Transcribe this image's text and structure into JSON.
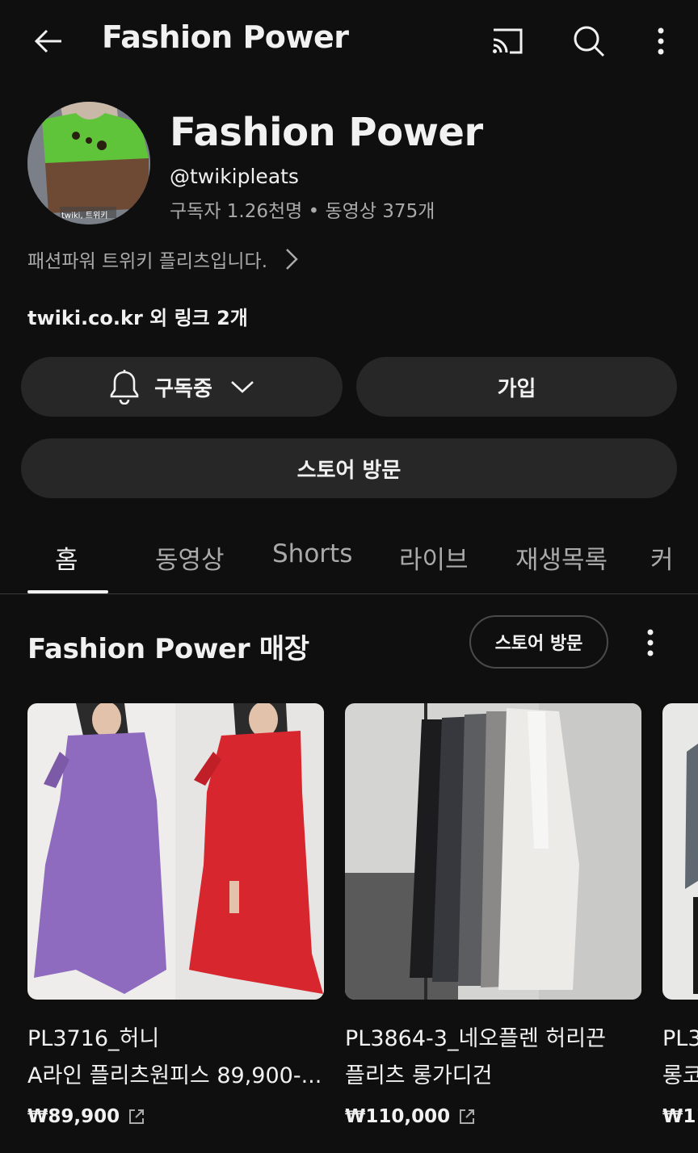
{
  "topbar": {
    "title": "Fashion Power"
  },
  "channel": {
    "name": "Fashion Power",
    "handle": "@twikipleats",
    "stats": "구독자 1.26천명 • 동영상 375개",
    "description": "패션파워 트위키 플리츠입니다.",
    "links": "twiki.co.kr 외 링크 2개",
    "avatar_caption": "twiki, 트위키"
  },
  "buttons": {
    "subscribed": "구독중",
    "join": "가입",
    "visit_store": "스토어 방문"
  },
  "tabs": [
    "홈",
    "동영상",
    "Shorts",
    "라이브",
    "재생목록",
    "커"
  ],
  "store_section": {
    "title": "Fashion Power 매장",
    "visit_store": "스토어 방문"
  },
  "products": [
    {
      "title_line1": "PL3716_허니",
      "title_line2": "A라인 플리츠원피스 89,900-...",
      "price": "₩89,900"
    },
    {
      "title_line1": "PL3864-3_네오플렌 허리끈",
      "title_line2": "플리츠 롱가디건",
      "price": "₩110,000"
    },
    {
      "title_line1": "PL3",
      "title_line2": "롱코",
      "price": "₩11"
    }
  ],
  "colors": {
    "background": "#0f0f0f",
    "pill": "#272727",
    "secondary_text": "#aaaaaa"
  }
}
